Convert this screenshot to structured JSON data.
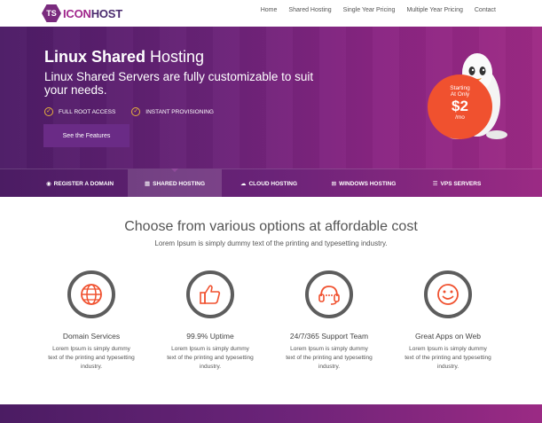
{
  "logo": {
    "badge": "TS",
    "icon": "ICON",
    "host": "HOST"
  },
  "nav": [
    "Home",
    "Shared Hosting",
    "Single Year Pricing",
    "Multiple Year Pricing",
    "Contact"
  ],
  "hero": {
    "title_bold": "Linux Shared",
    "title_rest": " Hosting",
    "subtitle": "Linux Shared Servers are fully customizable to suit your needs.",
    "features": [
      "FULL ROOT ACCESS",
      "INSTANT PROVISIONING"
    ],
    "cta": "See the Features",
    "price": {
      "line1": "Starting",
      "line2": "At Only",
      "amount": "$2",
      "unit": "/mo"
    }
  },
  "tabs": [
    {
      "label": "REGISTER A DOMAIN",
      "icon": "globe-icon",
      "active": false
    },
    {
      "label": "SHARED HOSTING",
      "icon": "grid-icon",
      "active": true
    },
    {
      "label": "CLOUD HOSTING",
      "icon": "cloud-icon",
      "active": false
    },
    {
      "label": "WINDOWS HOSTING",
      "icon": "windows-icon",
      "active": false
    },
    {
      "label": "VPS SERVERS",
      "icon": "server-icon",
      "active": false
    }
  ],
  "main": {
    "title": "Choose from various options at affordable cost",
    "subtitle": "Lorem Ipsum is simply dummy text of the printing and typesetting industry."
  },
  "services": [
    {
      "title": "Domain Services",
      "icon": "globe-icon",
      "desc": "Lorem Ipsum is simply dummy text of the printing and typesetting industry."
    },
    {
      "title": "99.9% Uptime",
      "icon": "thumbs-up-icon",
      "desc": "Lorem Ipsum is simply dummy text of the printing and typesetting industry."
    },
    {
      "title": "24/7/365 Support Team",
      "icon": "headset-icon",
      "desc": "Lorem Ipsum is simply dummy text of the printing and typesetting industry."
    },
    {
      "title": "Great Apps on Web",
      "icon": "smiley-icon",
      "desc": "Lorem Ipsum is simply dummy text of the printing and typesetting industry."
    }
  ],
  "colors": {
    "accent": "#f0512f",
    "purple": "#6a2378",
    "gold": "#e7b13d"
  }
}
